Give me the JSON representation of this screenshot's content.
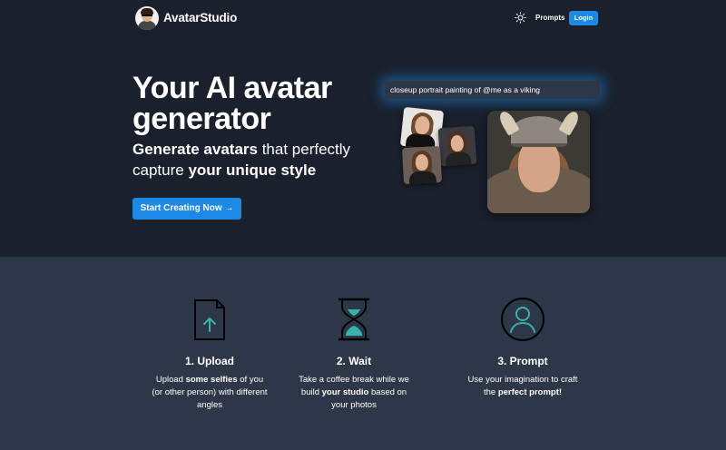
{
  "nav": {
    "brand": "AvatarStudio",
    "prompts_label": "Prompts",
    "login_label": "Login"
  },
  "hero": {
    "title": "Your AI avatar generator",
    "subtitle_bold_1": "Generate avatars",
    "subtitle_text_1": " that perfectly capture ",
    "subtitle_bold_2": "your unique style",
    "cta_label": "Start Creating Now →",
    "prompt_text": "closeup portrait painting of @me as a viking"
  },
  "steps": [
    {
      "title": "1. Upload",
      "desc_1": "Upload ",
      "desc_bold": "some selfies",
      "desc_2": " of you (or other person) with different angles",
      "icon": "upload-file-icon"
    },
    {
      "title": "2. Wait",
      "desc_1": "Take a coffee break while we build ",
      "desc_bold": "your studio",
      "desc_2": " based on your photos",
      "icon": "hourglass-icon"
    },
    {
      "title": "3. Prompt",
      "desc_1": "Use your imagination to craft the ",
      "desc_bold": "perfect prompt!",
      "desc_2": "",
      "icon": "user-circle-icon"
    }
  ],
  "colors": {
    "hero_bg": "#1a202c",
    "section_bg": "#2d3748",
    "accent": "#1e88e5",
    "icon_teal": "#38b2ac"
  }
}
